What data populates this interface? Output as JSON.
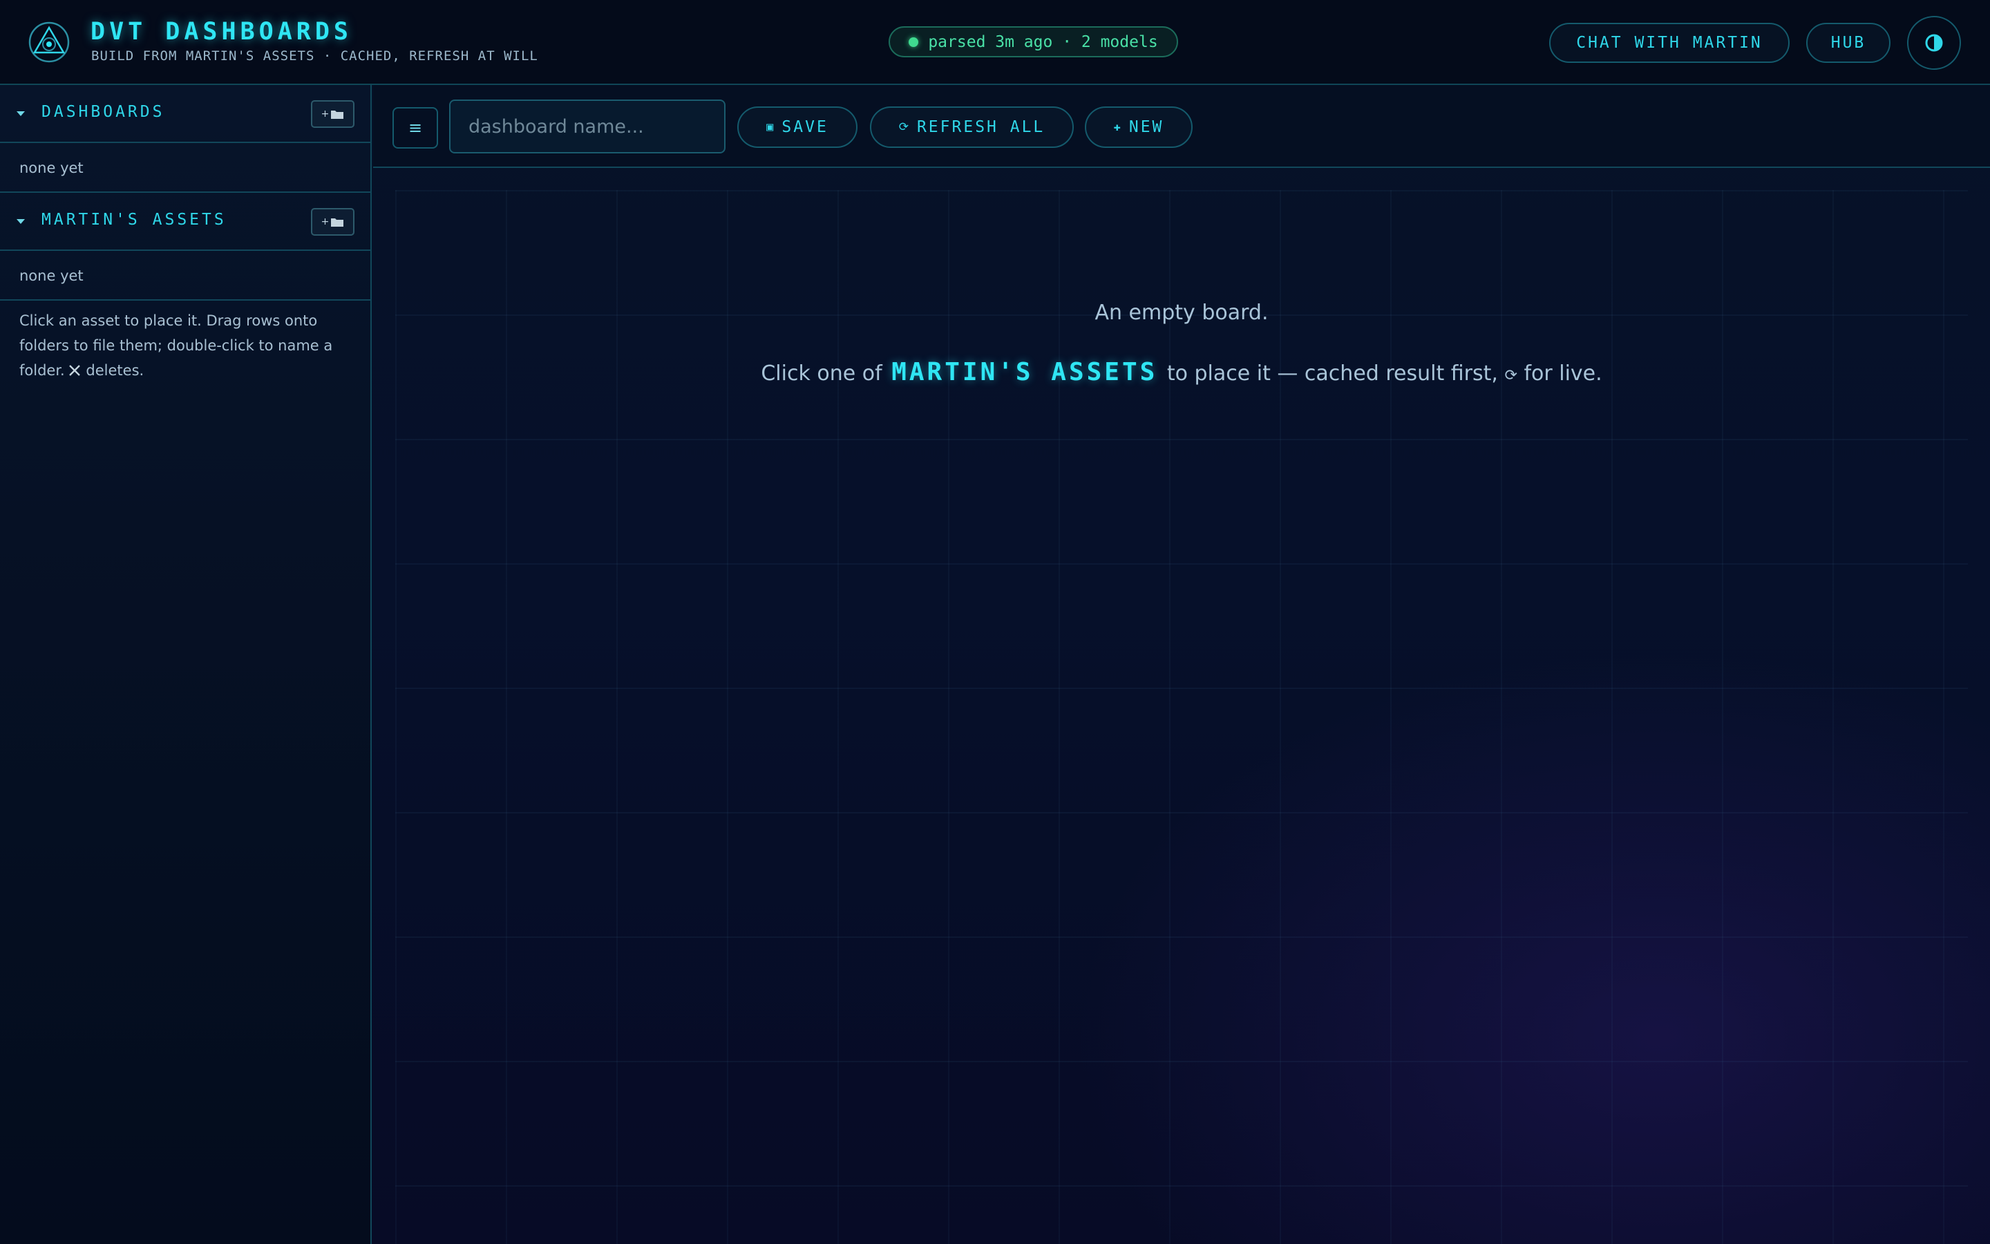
{
  "header": {
    "title": "DVT DASHBOARDS",
    "subtitle": "BUILD FROM MARTIN'S ASSETS · CACHED, REFRESH AT WILL",
    "status": "parsed 3m ago · 2 models",
    "chat_label": "CHAT WITH MARTIN",
    "hub_label": "HUB",
    "theme_icon": "contrast-icon"
  },
  "sidebar": {
    "dashboards": {
      "title": "DASHBOARDS",
      "new_folder_label": "+",
      "empty_text": "none yet"
    },
    "assets": {
      "title": "MARTIN'S ASSETS",
      "new_folder_label": "+",
      "empty_text": "none yet"
    },
    "help_text": "Click an asset to place it. Drag rows onto folders to file them; double-click to name a folder.",
    "help_suffix": "deletes."
  },
  "toolbar": {
    "menu_glyph": "≡",
    "name_placeholder": "dashboard name...",
    "name_value": "",
    "save_glyph": "▣",
    "save_label": "SAVE",
    "refresh_glyph": "⟳",
    "refresh_label": "REFRESH ALL",
    "new_glyph": "✚",
    "new_label": "NEW"
  },
  "board": {
    "empty_title": "An empty board.",
    "hint_prefix": "Click one of",
    "hint_accent": "MARTIN'S ASSETS",
    "hint_mid": "to place it — cached result first,",
    "hint_glyph": "⟳",
    "hint_suffix": "for live."
  },
  "colors": {
    "accent": "#2fe6f4",
    "status_green": "#49e0a6",
    "border": "#11475a",
    "background": "#050c1c"
  }
}
